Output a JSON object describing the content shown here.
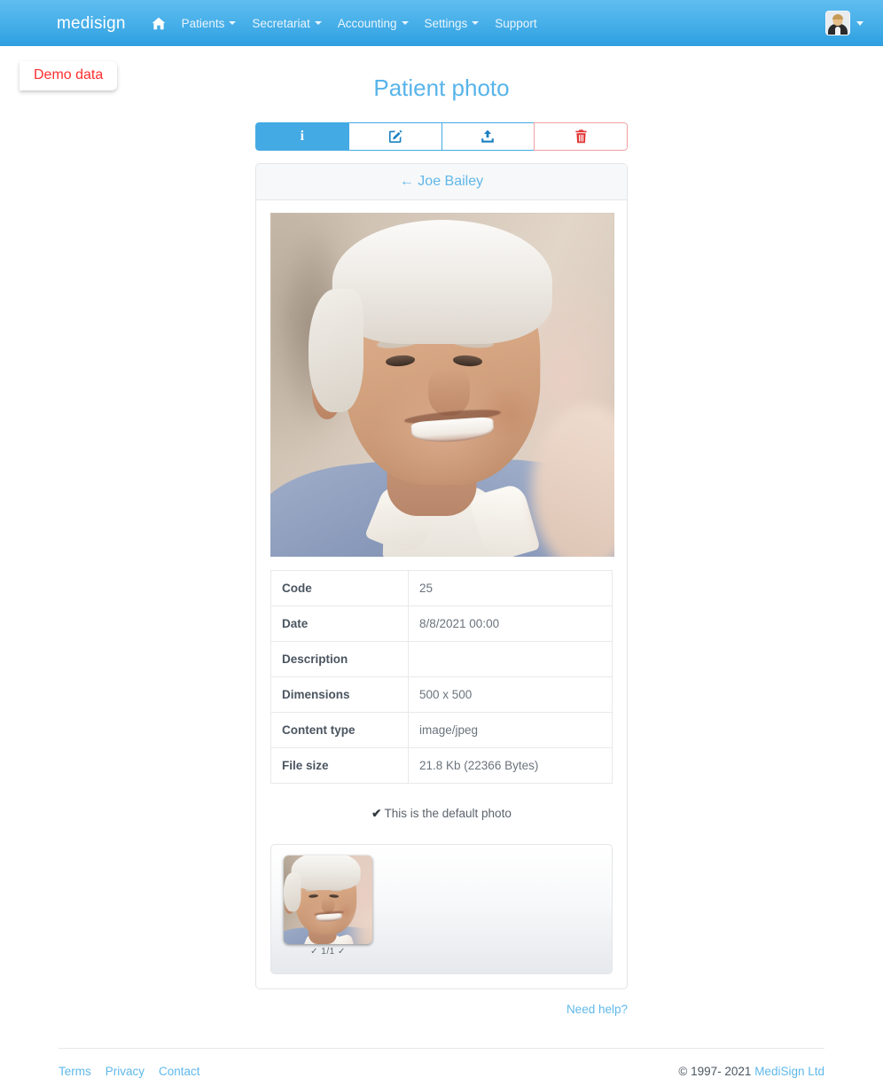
{
  "navbar": {
    "brand": "medisign",
    "home_icon": "home-icon",
    "items": [
      {
        "label": "Patients",
        "has_caret": true
      },
      {
        "label": "Secretariat",
        "has_caret": true
      },
      {
        "label": "Accounting",
        "has_caret": true
      },
      {
        "label": "Settings",
        "has_caret": true
      },
      {
        "label": "Support",
        "has_caret": false
      }
    ],
    "avatar": "user-avatar",
    "avatar_caret": "chevron-down-icon"
  },
  "demo_badge": {
    "label": "Demo data",
    "color": "#ff2d2d"
  },
  "page": {
    "title": "Patient photo"
  },
  "toolbar": {
    "buttons": [
      {
        "name": "info-button",
        "icon": "info-icon",
        "glyph": "i",
        "active": true,
        "variant": "primary"
      },
      {
        "name": "edit-button",
        "icon": "pencil-square-icon",
        "glyph": "",
        "active": false,
        "variant": "outline"
      },
      {
        "name": "upload-button",
        "icon": "upload-icon",
        "glyph": "",
        "active": false,
        "variant": "outline"
      },
      {
        "name": "delete-button",
        "icon": "trash-icon",
        "glyph": "",
        "active": false,
        "variant": "danger"
      }
    ]
  },
  "card": {
    "back_link": "← Joe Bailey",
    "patient_name": "Joe Bailey",
    "photo_alt": "patient-photo"
  },
  "table": {
    "rows": [
      {
        "key": "Code",
        "value": "25"
      },
      {
        "key": "Date",
        "value": "8/8/2021 00:00"
      },
      {
        "key": "Description",
        "value": ""
      },
      {
        "key": "Dimensions",
        "value": "500 x 500"
      },
      {
        "key": "Content type",
        "value": "image/jpeg"
      },
      {
        "key": "File size",
        "value": "21.8 Kb (22366 Bytes)"
      }
    ]
  },
  "default_note": {
    "check": "✔",
    "text": "This is the default photo"
  },
  "gallery": {
    "counter": "✓ 1/1 ✓",
    "thumb_alt": "photo-thumbnail"
  },
  "need_help": {
    "label": "Need help?"
  },
  "footer": {
    "links": [
      "Terms",
      "Privacy",
      "Contact"
    ],
    "copyright_prefix": "© 1997- 2021 ",
    "company": "MediSign Ltd"
  },
  "colors": {
    "brand_blue": "#44aae4",
    "link_blue": "#5fb8ea",
    "danger_red": "#e23636"
  }
}
